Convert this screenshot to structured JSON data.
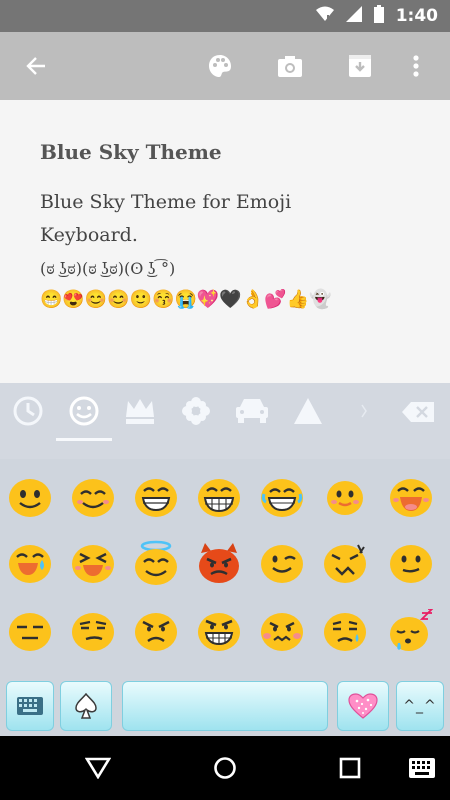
{
  "status": {
    "time": "1:40"
  },
  "toolbar": {
    "back_icon": "arrow-left-icon",
    "palette_icon": "palette-icon",
    "camera_icon": "camera-icon",
    "save_icon": "download-icon",
    "menu_icon": "more-vert-icon"
  },
  "content": {
    "title": "Blue Sky Theme",
    "desc_line1": "Blue Sky Theme for Emoji",
    "desc_line2": "Keyboard.",
    "kaomoji": "(ಠ ͜ʖಠ)(ಠ ͜ʖಠ)(ʘ ͜ʖ ͡°)",
    "emoji_strip": "😁😍😊😊🙂😚😭💖🖤👌💕👍👻"
  },
  "keyboard": {
    "categories": [
      "recent-clock-icon",
      "smiley-icon",
      "crown-icon",
      "flower-icon",
      "car-icon",
      "triangle-icon"
    ],
    "active_category": "smiley-icon",
    "emoji_rows": [
      [
        "🙂",
        "😊",
        "😁",
        "😁",
        "😂",
        "🙂",
        "😆"
      ],
      [
        "😅",
        "😆",
        "😇",
        "😈",
        "😉",
        "😖",
        "🙂"
      ],
      [
        "😑",
        "😏",
        "😠",
        "😠",
        "😤",
        "😥",
        "😴"
      ]
    ],
    "bottom_keys": {
      "keyboard_icon": "keyboard-icon",
      "spade_icon": "spade-icon",
      "heart_icon": "heart-icon",
      "kaomoji_label": "^_^"
    }
  },
  "colors": {
    "status_bar": "#757575",
    "toolbar": "#bdbdbd",
    "key_gradient_top": "#e9fbfd",
    "key_gradient_bottom": "#9fe3ef"
  }
}
